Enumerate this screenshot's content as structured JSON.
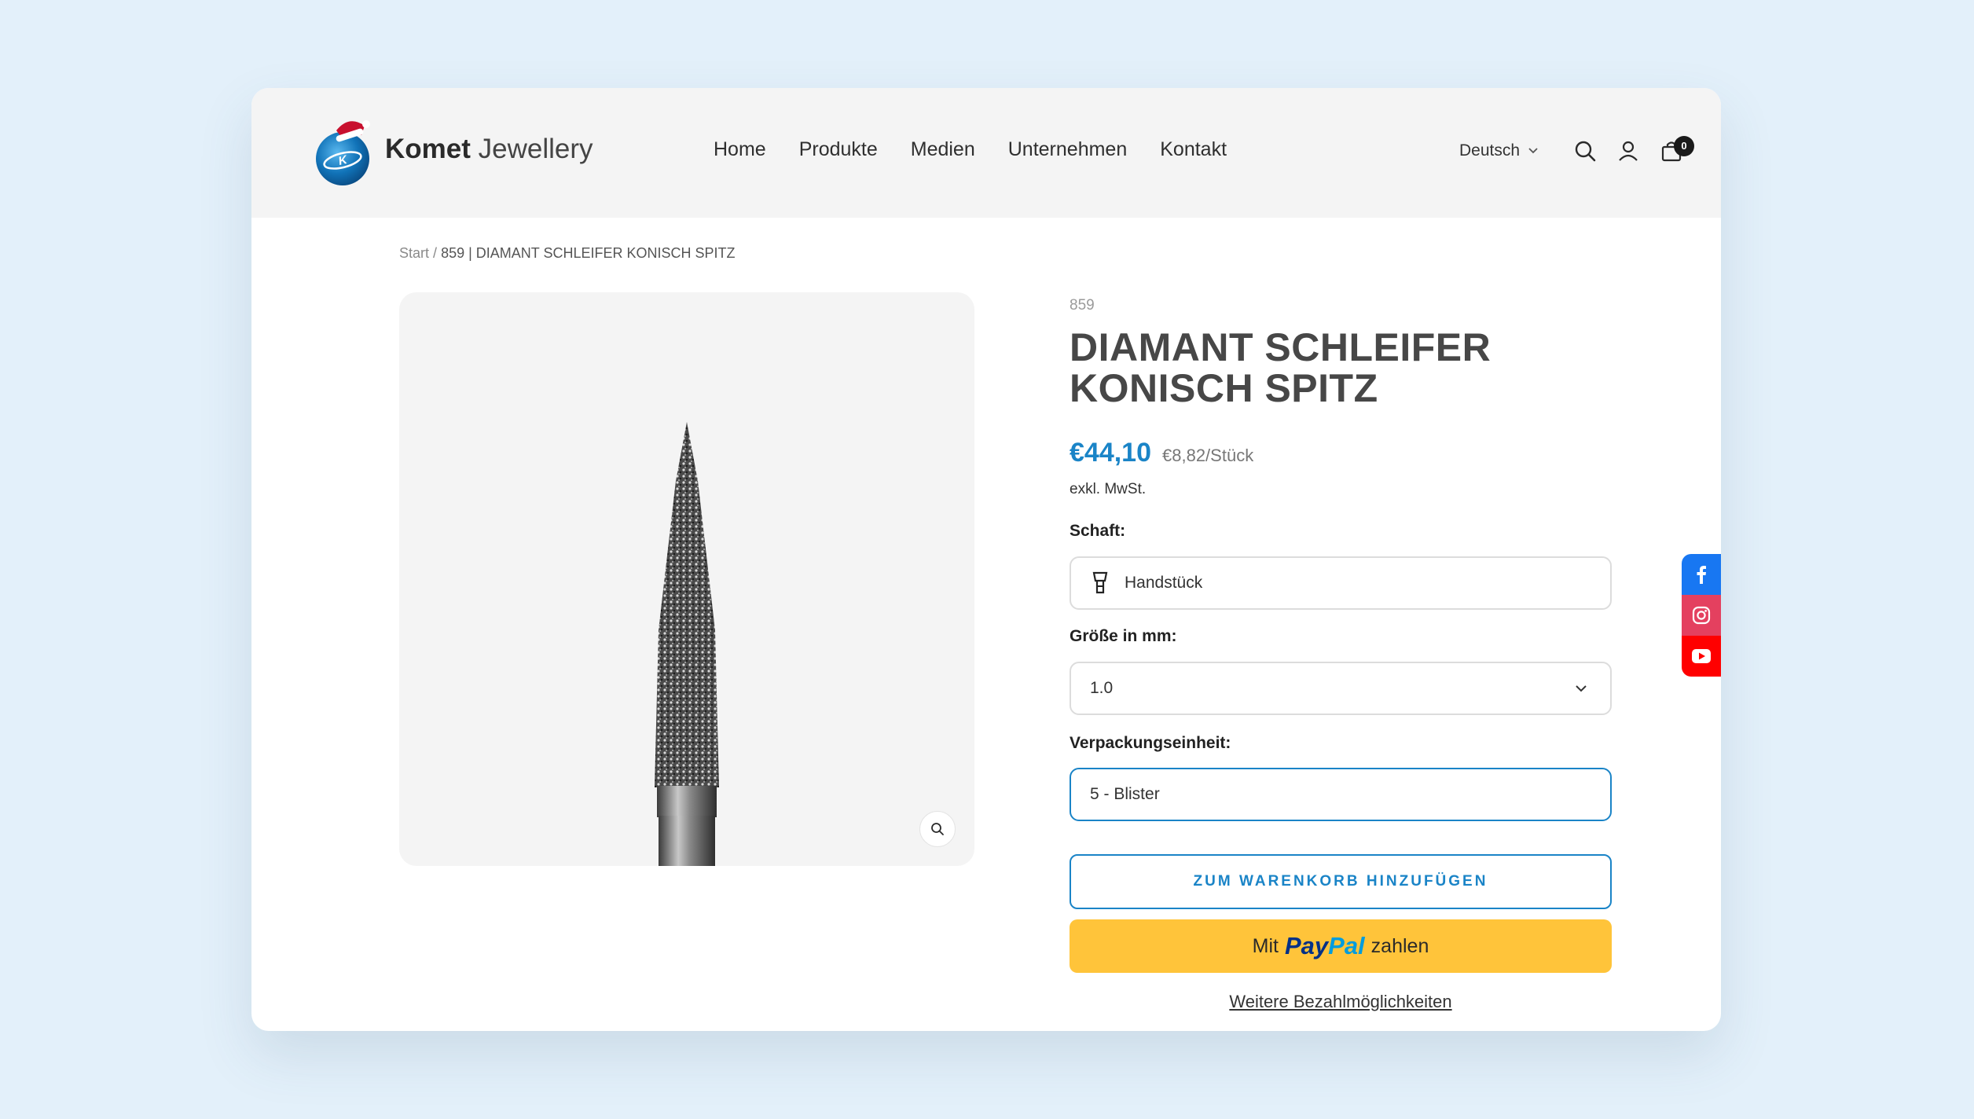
{
  "brand": {
    "name_bold": "Komet",
    "name_light": "Jewellery",
    "mark_text": "Komet"
  },
  "nav": [
    {
      "label": "Home"
    },
    {
      "label": "Produkte"
    },
    {
      "label": "Medien"
    },
    {
      "label": "Unternehmen"
    },
    {
      "label": "Kontakt"
    }
  ],
  "header": {
    "language": "Deutsch",
    "cart_count": "0"
  },
  "breadcrumb": {
    "start": "Start",
    "separator": "/",
    "current": "859 | DIAMANT SCHLEIFER KONISCH SPITZ"
  },
  "product": {
    "sku": "859",
    "title": "DIAMANT SCHLEIFER KONISCH SPITZ",
    "price": "€44,10",
    "unit_price": "€8,82/Stück",
    "tax_note": "exkl. MwSt."
  },
  "options": {
    "shaft_label": "Schaft:",
    "shaft_value": "Handstück",
    "size_label": "Größe in mm:",
    "size_value": "1.0",
    "pack_label": "Verpackungseinheit:",
    "pack_value": "5 - Blister"
  },
  "actions": {
    "add_to_cart": "ZUM WARENKORB HINZUFÜGEN",
    "paypal_prefix": "Mit",
    "paypal_brand_pay": "Pay",
    "paypal_brand_pal": "Pal",
    "paypal_suffix": "zahlen",
    "more_payment": "Weitere Bezahlmöglichkeiten"
  },
  "colors": {
    "accent": "#1a84c7",
    "paypal": "#ffc43a",
    "facebook": "#1877f2",
    "instagram": "#e4405f",
    "youtube": "#ff0000"
  },
  "social": [
    {
      "icon": "facebook-icon"
    },
    {
      "icon": "instagram-icon"
    },
    {
      "icon": "youtube-icon"
    }
  ]
}
